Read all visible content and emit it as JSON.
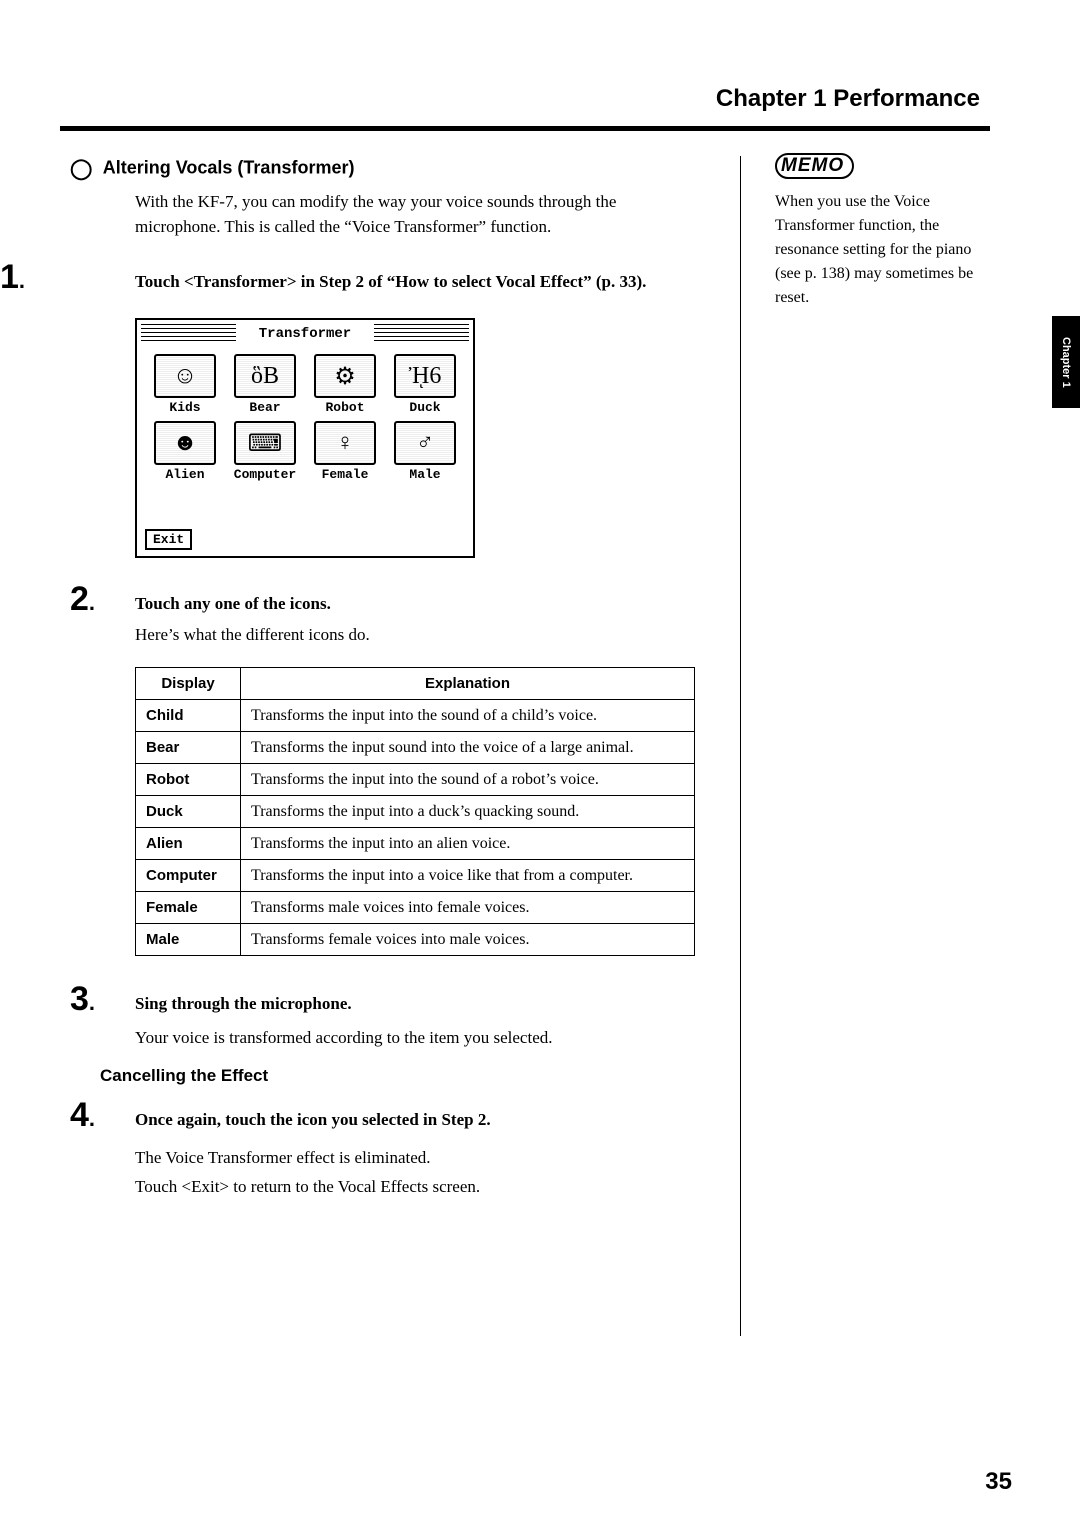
{
  "header": {
    "title": "Chapter 1 Performance"
  },
  "section": {
    "title": "Altering Vocals (Transformer)",
    "intro": "With the KF-7, you can modify the way your voice sounds through the microphone. This is called the “Voice Transformer” function."
  },
  "steps": {
    "s1": {
      "num": "1",
      "text": "Touch <Transformer> in Step 2 of “How to select Vocal Effect” (p. 33)."
    },
    "s2": {
      "num": "2",
      "text": "Touch any one of the icons.",
      "after": "Here’s what the different icons do."
    },
    "s3": {
      "num": "3",
      "text": "Sing through the microphone.",
      "after": "Your voice is transformed according to the item you selected."
    },
    "cancel_title": "Cancelling the Effect",
    "s4": {
      "num": "4",
      "text": "Once again, touch the icon you selected in Step 2.",
      "after1": "The Voice Transformer effect is eliminated.",
      "after2": "Touch <Exit> to return to the Vocal Effects screen."
    }
  },
  "screen": {
    "title": "Transformer",
    "icons": {
      "kids": {
        "label": "Kids",
        "glyph": "☺"
      },
      "bear": {
        "label": "Bear",
        "glyph": "ὃB"
      },
      "robot": {
        "label": "Robot",
        "glyph": "⚙"
      },
      "duck": {
        "label": "Duck",
        "glyph": "ᾘ6"
      },
      "alien": {
        "label": "Alien",
        "glyph": "☻"
      },
      "computer": {
        "label": "Computer",
        "glyph": "⌨"
      },
      "female": {
        "label": "Female",
        "glyph": "♀"
      },
      "male": {
        "label": "Male",
        "glyph": "♂"
      }
    },
    "exit": "Exit"
  },
  "table": {
    "headers": {
      "display": "Display",
      "explanation": "Explanation"
    },
    "rows": [
      {
        "display": "Child",
        "explanation": "Transforms the input into the sound of a child’s voice."
      },
      {
        "display": "Bear",
        "explanation": "Transforms the input sound into the voice of a large animal."
      },
      {
        "display": "Robot",
        "explanation": "Transforms the input into the sound of a robot’s voice."
      },
      {
        "display": "Duck",
        "explanation": "Transforms the input into a duck’s quacking sound."
      },
      {
        "display": "Alien",
        "explanation": "Transforms the input into an alien voice."
      },
      {
        "display": "Computer",
        "explanation": "Transforms the input into a voice like that from a computer."
      },
      {
        "display": "Female",
        "explanation": "Transforms male voices into female voices."
      },
      {
        "display": "Male",
        "explanation": "Transforms female voices into male voices."
      }
    ]
  },
  "memo": {
    "badge": "MEMO",
    "text": "When you use the Voice Transformer function, the resonance setting for the piano (see p. 138) may sometimes be reset."
  },
  "side_tab": "Chapter 1",
  "page_number": "35"
}
